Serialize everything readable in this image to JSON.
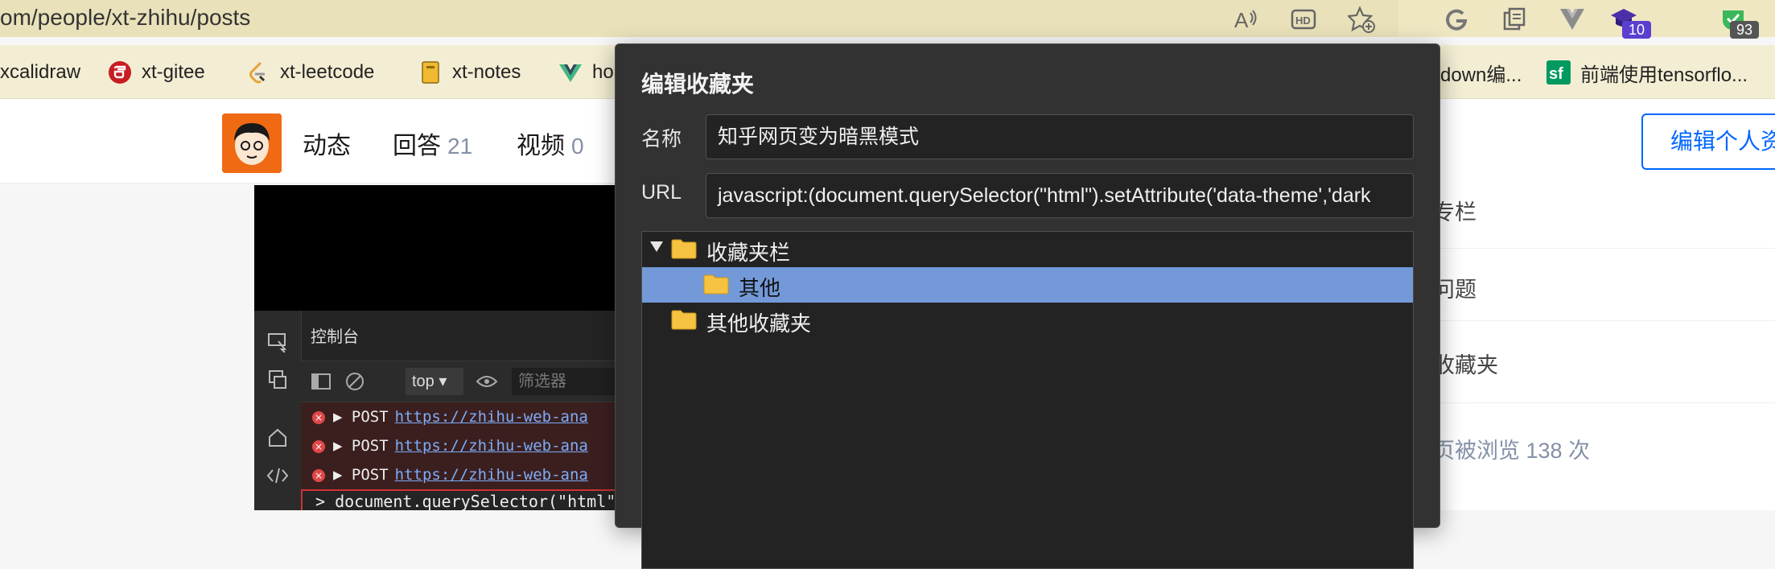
{
  "browser": {
    "url_host_fragment": "om",
    "url_path": "/people/xt-zhihu/posts",
    "icons": [
      "read-aloud-icon",
      "hd-icon",
      "add-favorite-icon",
      "grammarly-icon",
      "collections-icon",
      "vuejs-devtools-icon",
      "extension-badge-icon",
      "extension-check-icon"
    ],
    "badges": {
      "extension_purple": "10",
      "extension_green": "93"
    },
    "colors": {
      "address_bar": "#e9e1b9",
      "badge_purple": "#5b3fd0",
      "badge_green": "#2aa34a"
    }
  },
  "bookmarks": [
    {
      "label": "xcalidraw",
      "icon": ""
    },
    {
      "label": "xt-gitee",
      "icon": "gitee-icon"
    },
    {
      "label": "xt-leetcode",
      "icon": "leetcode-icon"
    },
    {
      "label": "xt-notes",
      "icon": "notebook-icon"
    },
    {
      "label": "ho",
      "icon": "vue-icon"
    },
    {
      "label": "down编...",
      "icon": ""
    },
    {
      "label": "前端使用tensorflo...",
      "icon": "segmentfault-icon"
    }
  ],
  "profile_header": {
    "tabs": [
      {
        "label": "动态",
        "count": ""
      },
      {
        "label": "回答",
        "count": "21"
      },
      {
        "label": "视频",
        "count": "0"
      }
    ],
    "edit_button": "编辑个人资",
    "colors": {
      "accent": "#0066ff",
      "avatar_bg": "#f06a14"
    }
  },
  "devtools": {
    "panel_title": "控制台",
    "context": "top",
    "filter_placeholder": "筛选器",
    "errors": [
      {
        "method": "POST",
        "url": "https://zhihu-web-ana"
      },
      {
        "method": "POST",
        "url": "https://zhihu-web-ana"
      },
      {
        "method": "POST",
        "url": "https://zhihu-web-ana"
      }
    ],
    "command": "document.querySelector(\"html\""
  },
  "sidebar": {
    "items": [
      "专栏",
      "问题",
      "收藏夹",
      "页被浏览 138 次"
    ]
  },
  "dialog": {
    "title": "编辑收藏夹",
    "name_label": "名称",
    "name_value": "知乎网页变为暗黑模式",
    "url_label": "URL",
    "url_value": "javascript:(document.querySelector(\"html\").setAttribute('data-theme','dark",
    "folders": [
      {
        "label": "收藏夹栏",
        "expanded": true,
        "selected": false,
        "level": 0
      },
      {
        "label": "其他",
        "expanded": false,
        "selected": true,
        "level": 1
      },
      {
        "label": "其他收藏夹",
        "expanded": false,
        "selected": false,
        "level": 0
      }
    ],
    "colors": {
      "background": "#323232",
      "selection": "#7399d8",
      "folder": "#f5c242"
    }
  }
}
